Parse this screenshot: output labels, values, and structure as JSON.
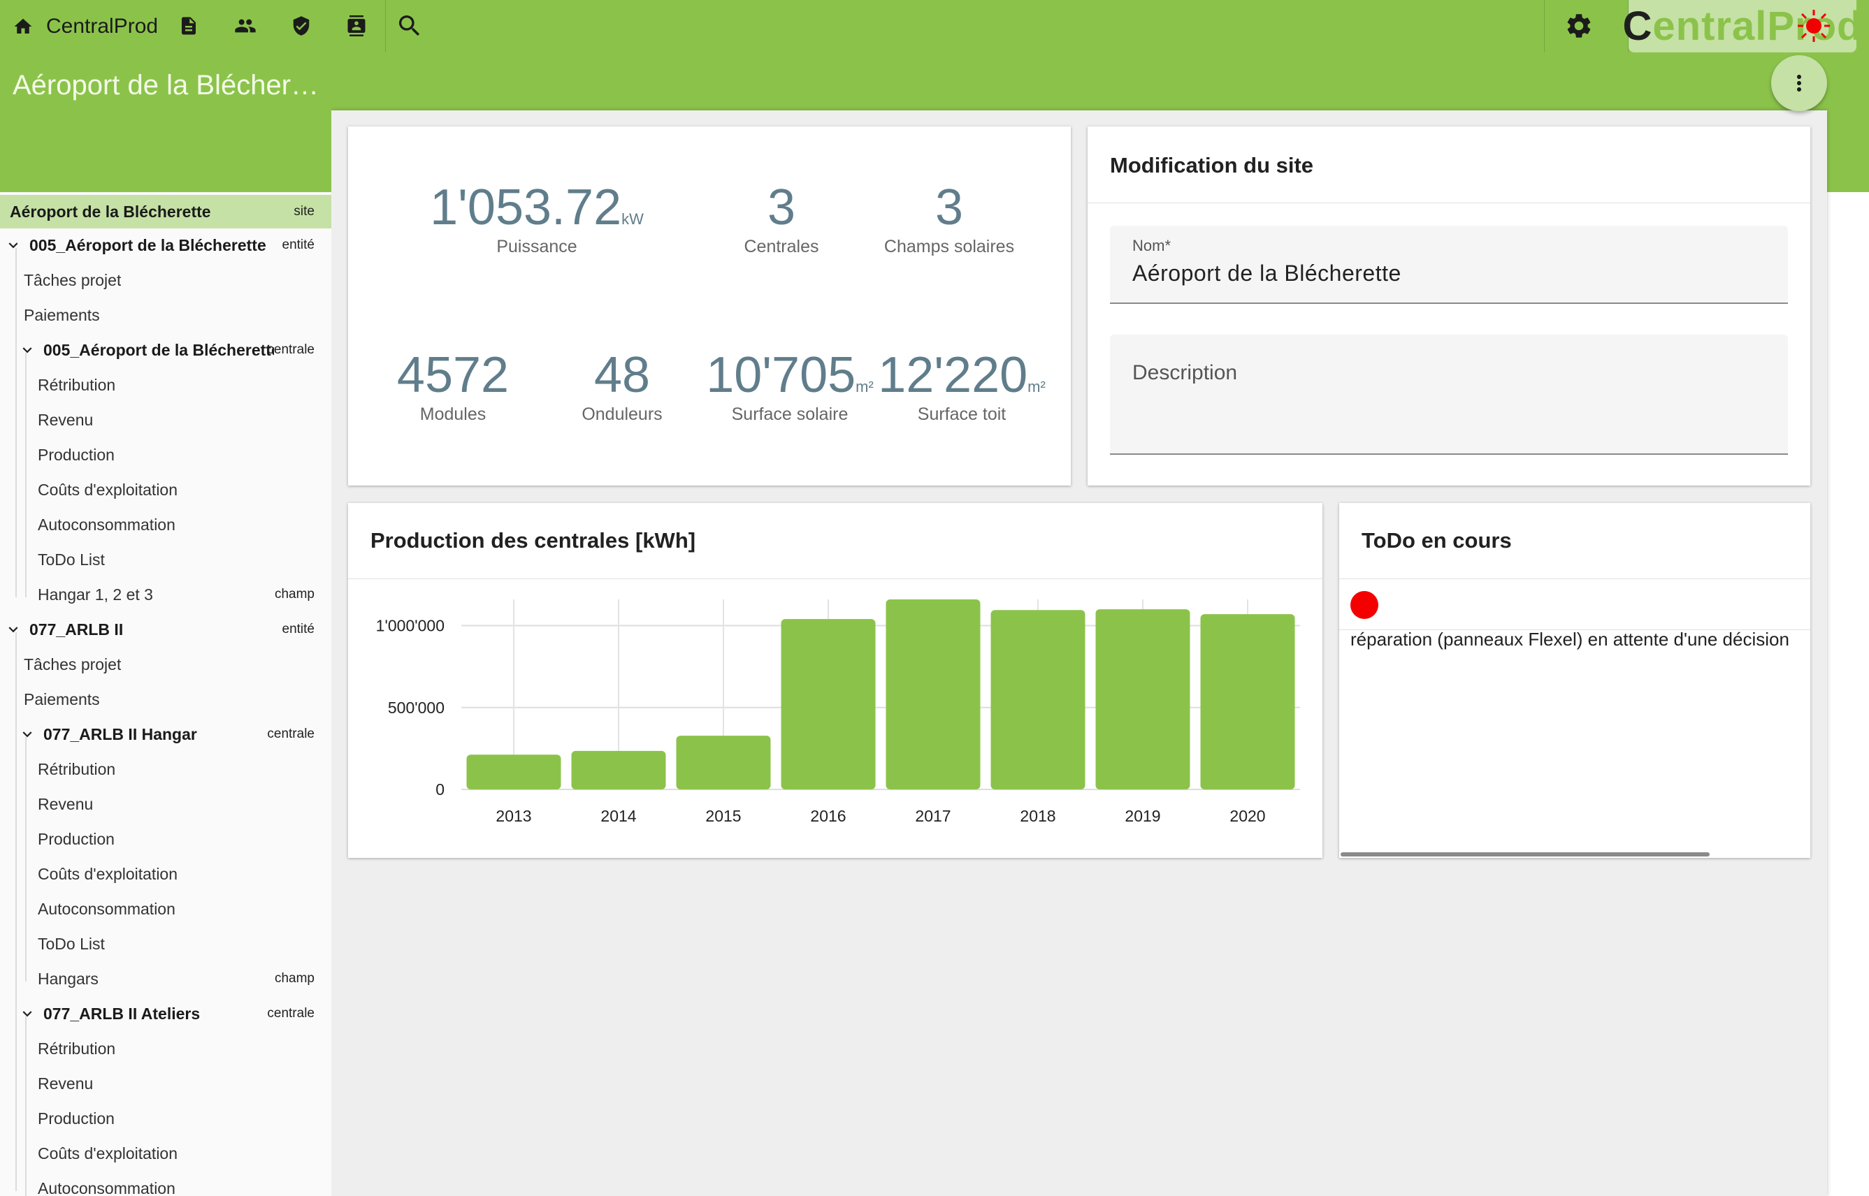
{
  "app": {
    "name": "CentralProd",
    "logo_first": "C",
    "logo_rest": "entralProd",
    "site_title": "Aéroport de la Blécherette"
  },
  "sidebar": {
    "items": [
      {
        "label": "Aéroport de la Blécherette",
        "tag": "site"
      },
      {
        "label": "005_Aéroport de la Blécherette (...",
        "tag": "entité"
      },
      {
        "label": "Tâches projet",
        "tag": ""
      },
      {
        "label": "Paiements",
        "tag": ""
      },
      {
        "label": "005_Aéroport de la Blécherette",
        "tag": "centrale"
      },
      {
        "label": "Rétribution",
        "tag": ""
      },
      {
        "label": "Revenu",
        "tag": ""
      },
      {
        "label": "Production",
        "tag": ""
      },
      {
        "label": "Coûts d'exploitation",
        "tag": ""
      },
      {
        "label": "Autoconsommation",
        "tag": ""
      },
      {
        "label": "ToDo List",
        "tag": ""
      },
      {
        "label": "Hangar 1, 2 et 3",
        "tag": "champ"
      },
      {
        "label": "077_ARLB II",
        "tag": "entité"
      },
      {
        "label": "Tâches projet",
        "tag": ""
      },
      {
        "label": "Paiements",
        "tag": ""
      },
      {
        "label": "077_ARLB II Hangar",
        "tag": "centrale"
      },
      {
        "label": "Rétribution",
        "tag": ""
      },
      {
        "label": "Revenu",
        "tag": ""
      },
      {
        "label": "Production",
        "tag": ""
      },
      {
        "label": "Coûts d'exploitation",
        "tag": ""
      },
      {
        "label": "Autoconsommation",
        "tag": ""
      },
      {
        "label": "ToDo List",
        "tag": ""
      },
      {
        "label": "Hangars",
        "tag": "champ"
      },
      {
        "label": "077_ARLB II Ateliers",
        "tag": "centrale"
      },
      {
        "label": "Rétribution",
        "tag": ""
      },
      {
        "label": "Revenu",
        "tag": ""
      },
      {
        "label": "Production",
        "tag": ""
      },
      {
        "label": "Coûts d'exploitation",
        "tag": ""
      },
      {
        "label": "Autoconsommation",
        "tag": ""
      }
    ]
  },
  "stats": {
    "puissance": {
      "value": "1'053.72",
      "unit": "kW",
      "label": "Puissance"
    },
    "centrales": {
      "value": "3",
      "label": "Centrales"
    },
    "champs": {
      "value": "3",
      "label": "Champs solaires"
    },
    "modules": {
      "value": "4572",
      "label": "Modules"
    },
    "onduleurs": {
      "value": "48",
      "label": "Onduleurs"
    },
    "surface_solaire": {
      "value": "10'705",
      "unit": "m²",
      "label": "Surface solaire"
    },
    "surface_toit": {
      "value": "12'220",
      "unit": "m²",
      "label": "Surface toit"
    }
  },
  "site_form": {
    "title": "Modification du site",
    "name_label": "Nom*",
    "name_value": "Aéroport de la Blécherette",
    "description_label": "Description"
  },
  "todo": {
    "title": "ToDo en cours",
    "items": [
      {
        "text": "réparation (panneaux Flexel) en attente d'une décision",
        "status_color": "#f50000"
      }
    ]
  },
  "chart_data": {
    "type": "bar",
    "title": "Production des centrales [kWh]",
    "categories": [
      "2013",
      "2014",
      "2015",
      "2016",
      "2017",
      "2018",
      "2019",
      "2020"
    ],
    "values": [
      212000,
      235000,
      328000,
      1040000,
      1160000,
      1095000,
      1100000,
      1070000
    ],
    "ylim": [
      0,
      1160000
    ],
    "yticks": [
      0,
      500000,
      1000000
    ],
    "ytick_labels": [
      "0",
      "500'000",
      "1'000'000"
    ],
    "bar_color": "#8bc34a",
    "grid": true
  },
  "colors": {
    "accent": "#8bc34a",
    "accent_light": "#c5e1a5",
    "stat_text": "#607d8b"
  }
}
